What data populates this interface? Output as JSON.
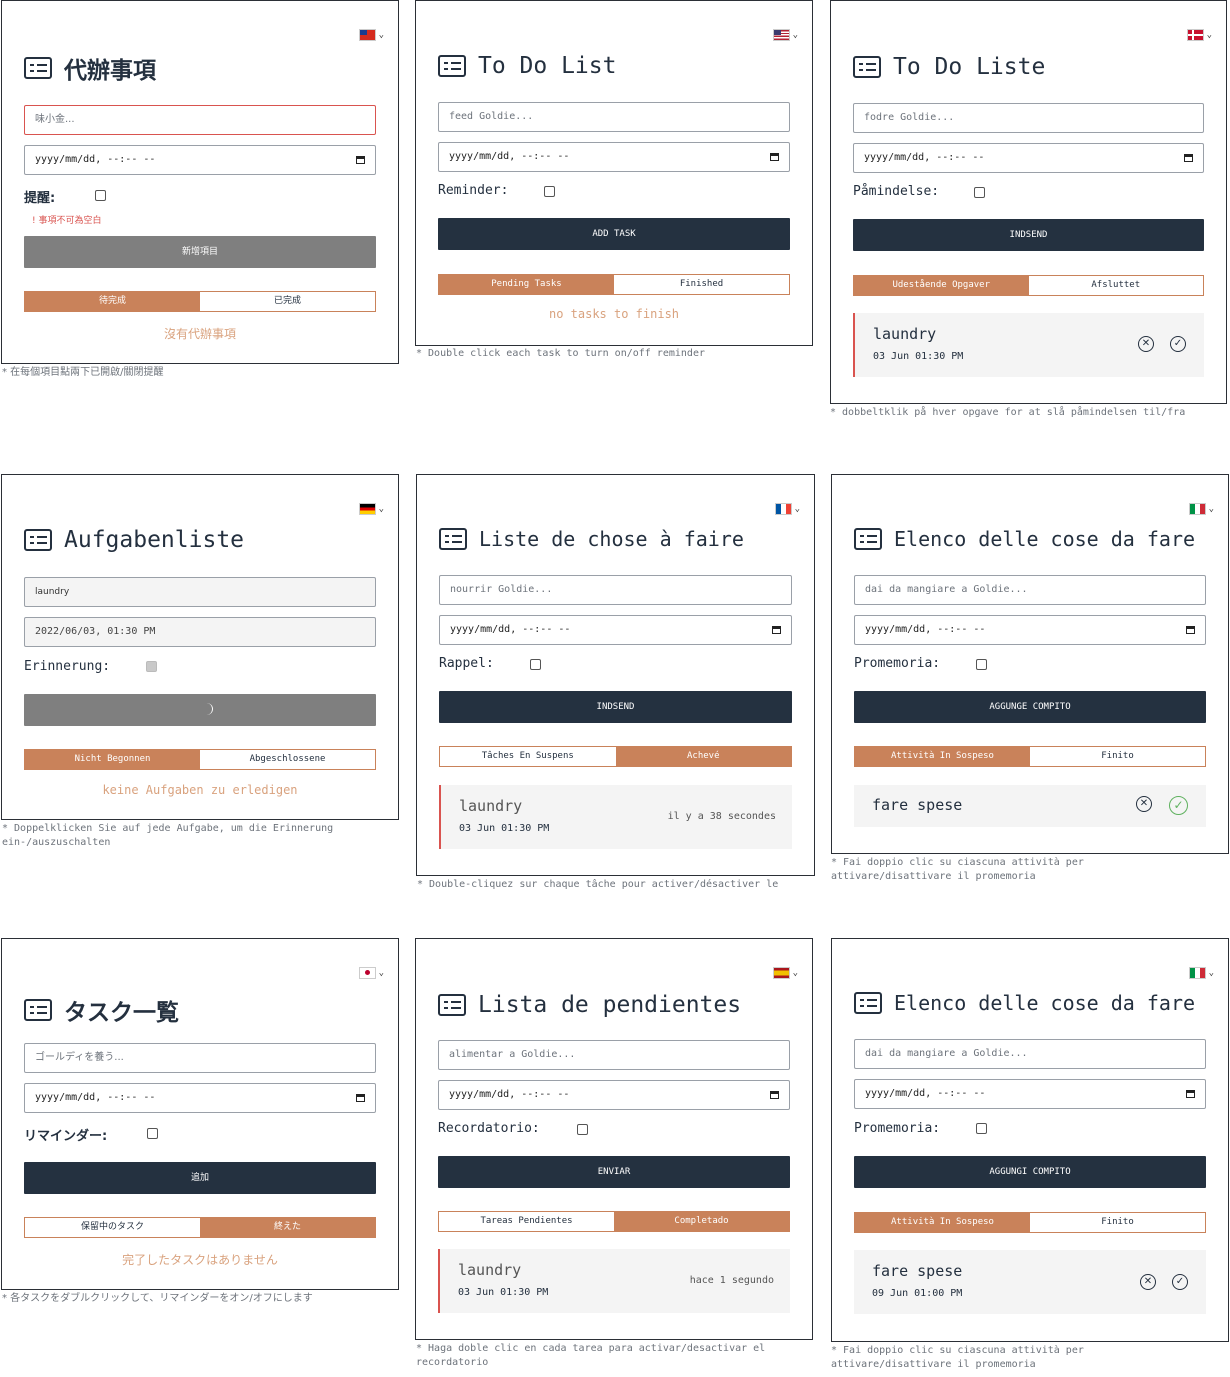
{
  "panels": [
    {
      "title": "代辦事項",
      "task_placeholder": "味小金...",
      "datetime": "yyyy/mm/dd, --:-- --",
      "reminder_label": "提醒:",
      "error": "事項不可為空白",
      "submit_label": "新增項目",
      "tab_pending": "待完成",
      "tab_finished": "已完成",
      "empty": "沒有代辦事項",
      "note": "* 在每個項目點兩下已開啟/關閉提醒"
    },
    {
      "title": "To Do List",
      "task_placeholder": "feed Goldie...",
      "datetime": "yyyy/mm/dd, --:-- --",
      "reminder_label": "Reminder:",
      "submit_label": "ADD TASK",
      "tab_pending": "Pending Tasks",
      "tab_finished": "Finished",
      "empty": "no tasks to finish",
      "note": "* Double click each task to turn on/off reminder"
    },
    {
      "title": "To Do Liste",
      "task_placeholder": "fodre Goldie...",
      "datetime": "yyyy/mm/dd, --:-- --",
      "reminder_label": "Påmindelse:",
      "submit_label": "INDSEND",
      "tab_pending": "Udestående Opgaver",
      "tab_finished": "Afsluttet",
      "task_name": "laundry",
      "task_date": "03 Jun 01:30 PM",
      "note": "* dobbeltklik på hver opgave for at slå påmindelsen til/fra"
    },
    {
      "title": "Aufgabenliste",
      "task_value": "laundry",
      "datetime": "2022/06/03, 01:30 PM",
      "reminder_label": "Erinnerung:",
      "tab_pending": "Nicht Begonnen",
      "tab_finished": "Abgeschlossene",
      "empty": "keine Aufgaben zu erledigen",
      "note": "* Doppelklicken Sie auf jede Aufgabe, um die Erinnerung ein-/auszuschalten"
    },
    {
      "title": "Liste de chose à faire",
      "task_placeholder": "nourrir Goldie...",
      "datetime": "yyyy/mm/dd, --:-- --",
      "reminder_label": "Rappel:",
      "submit_label": "INDSEND",
      "tab_pending": "Tâches En Suspens",
      "tab_finished": "Achevé",
      "task_name": "laundry",
      "task_date": "03 Jun 01:30 PM",
      "task_ago": "il y a 38 secondes",
      "note": "* Double-cliquez sur chaque tâche pour activer/désactiver le"
    },
    {
      "title": "Elenco delle cose da fare",
      "task_placeholder": "dai da mangiare a Goldie...",
      "datetime": "yyyy/mm/dd, --:-- --",
      "reminder_label": "Promemoria:",
      "submit_label": "AGGUNGE COMPITO",
      "tab_pending": "Attività In Sospeso",
      "tab_finished": "Finito",
      "task_name": "fare spese",
      "note": "* Fai doppio clic su ciascuna attività per attivare/disattivare il promemoria"
    },
    {
      "title": "タスク一覧",
      "task_placeholder": "ゴールディを養う...",
      "datetime": "yyyy/mm/dd, --:-- --",
      "reminder_label": "リマインダー:",
      "submit_label": "追加",
      "tab_pending": "保留中のタスク",
      "tab_finished": "終えた",
      "empty": "完了したタスクはありません",
      "note": "* 各タスクをダブルクリックして、リマインダーをオン/オフにします"
    },
    {
      "title": "Lista de pendientes",
      "task_placeholder": "alimentar a Goldie...",
      "datetime": "yyyy/mm/dd, --:-- --",
      "reminder_label": "Recordatorio:",
      "submit_label": "ENVIAR",
      "tab_pending": "Tareas Pendientes",
      "tab_finished": "Completado",
      "task_name": "laundry",
      "task_date": "03 Jun 01:30 PM",
      "task_ago": "hace 1 segundo",
      "note": "* Haga doble clic en cada tarea para activar/desactivar el recordatorio"
    },
    {
      "title": "Elenco delle cose da fare",
      "task_placeholder": "dai da mangiare a Goldie...",
      "datetime": "yyyy/mm/dd, --:-- --",
      "reminder_label": "Promemoria:",
      "submit_label": "AGGUNGI COMPITO",
      "tab_pending": "Attività In Sospeso",
      "tab_finished": "Finito",
      "task_name": "fare spese",
      "task_date": "09 Jun 01:00 PM",
      "note": "* Fai doppio clic su ciascuna attività per attivare/disattivare il promemoria"
    }
  ],
  "icons": {
    "title": "checklist-icon",
    "calendar": "calendar-icon",
    "delete": "x-circle-icon",
    "done": "check-circle-icon",
    "language": "chevron-down-icon"
  },
  "colors": {
    "accent": "#c9825a",
    "dark": "#243140",
    "error": "#d9534f",
    "disabled": "#7f7f7f"
  }
}
